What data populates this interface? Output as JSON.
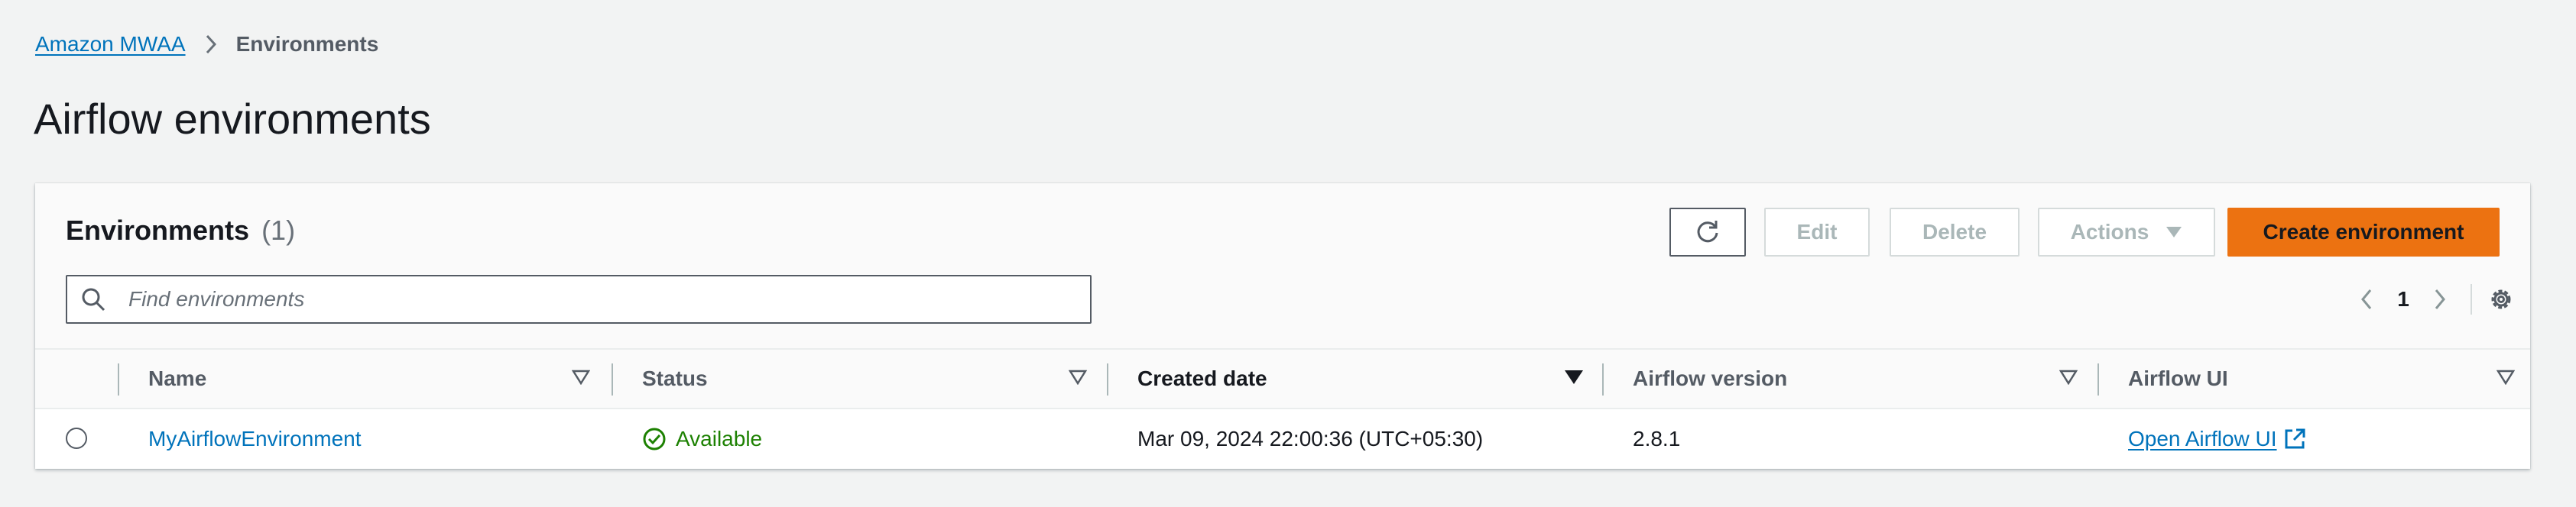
{
  "breadcrumb": {
    "parent": "Amazon MWAA",
    "current": "Environments"
  },
  "page": {
    "title": "Airflow environments"
  },
  "environments_panel": {
    "title": "Environments",
    "count": "(1)",
    "buttons": {
      "refresh_icon": "refresh-icon",
      "edit": "Edit",
      "delete": "Delete",
      "actions": "Actions",
      "create": "Create environment"
    },
    "search": {
      "placeholder": "Find environments",
      "value": ""
    },
    "pagination": {
      "current_page": "1"
    },
    "columns": [
      "Name",
      "Status",
      "Created date",
      "Airflow version",
      "Airflow UI"
    ],
    "sorted_column": "Created date",
    "rows": [
      {
        "name": "MyAirflowEnvironment",
        "status": "Available",
        "created_date": "Mar 09, 2024 22:00:36 (UTC+05:30)",
        "airflow_version": "2.8.1",
        "airflow_ui": "Open Airflow UI"
      }
    ]
  },
  "colors": {
    "link": "#0073bb",
    "primary_button": "#ec7211",
    "status_available": "#1d8102",
    "background": "#f2f3f3"
  }
}
